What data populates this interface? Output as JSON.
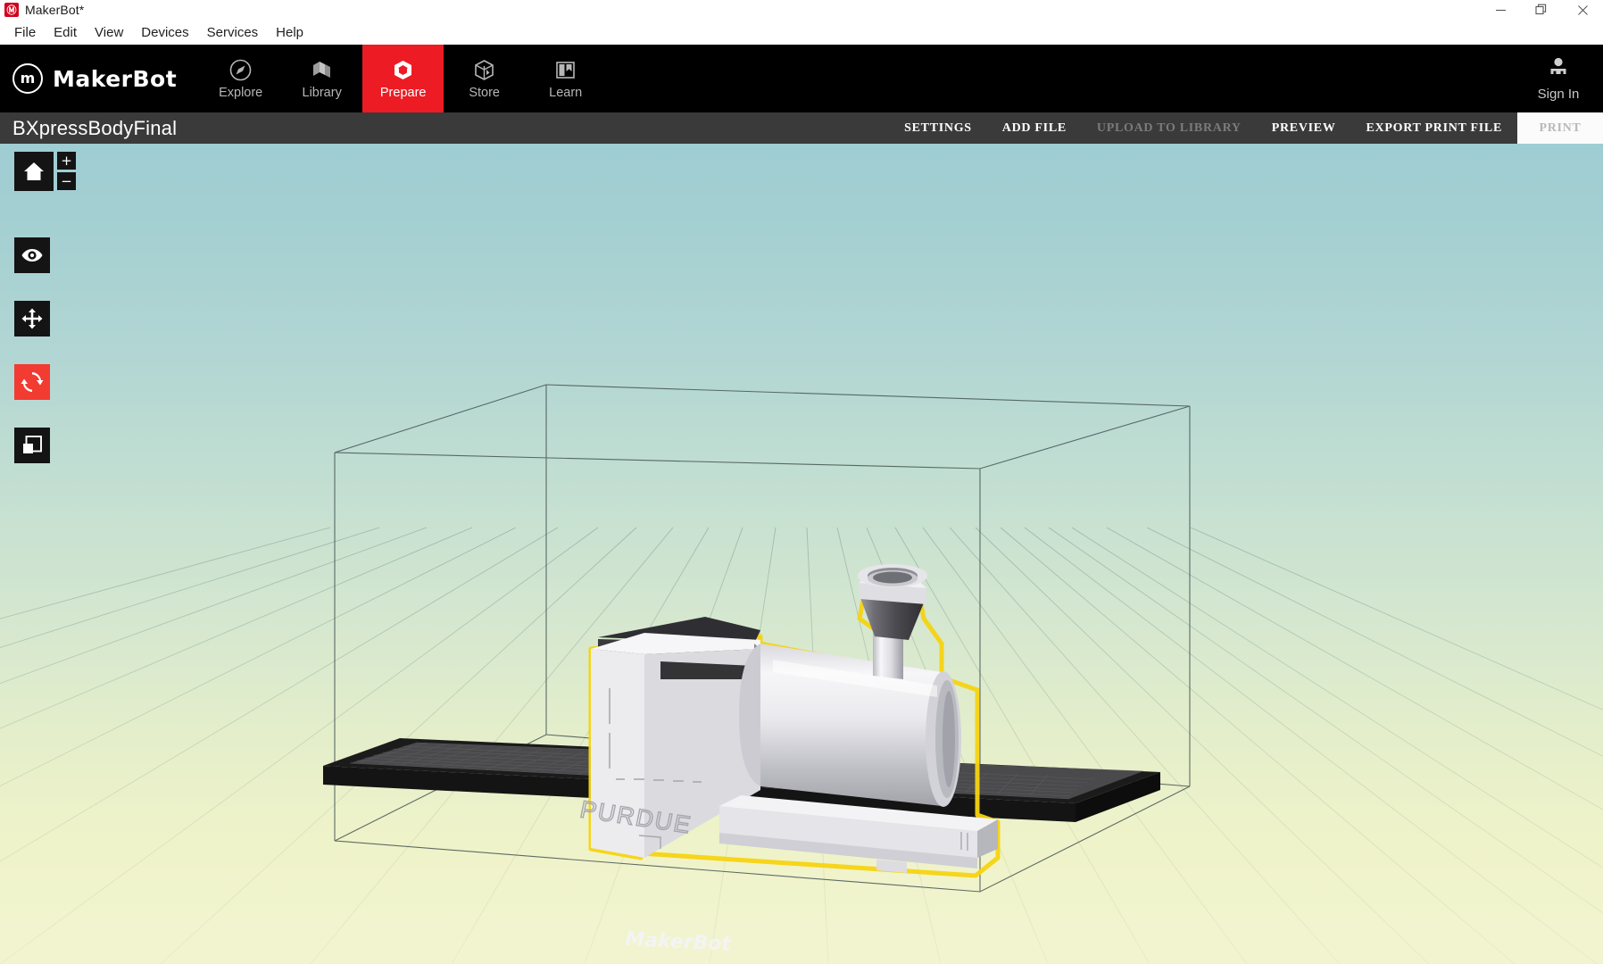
{
  "window": {
    "title": "MakerBot*",
    "app_icon": "makerbot-logo-icon",
    "controls": {
      "minimize": "minimize-icon",
      "restore": "restore-icon",
      "close": "close-icon"
    }
  },
  "menubar": {
    "items": [
      {
        "label": "File"
      },
      {
        "label": "Edit"
      },
      {
        "label": "View"
      },
      {
        "label": "Devices"
      },
      {
        "label": "Services"
      },
      {
        "label": "Help"
      }
    ]
  },
  "navbar": {
    "brand": {
      "mark": "m",
      "name": "MakerBot"
    },
    "tabs": [
      {
        "label": "Explore",
        "icon": "compass-icon",
        "active": false
      },
      {
        "label": "Library",
        "icon": "books-icon",
        "active": false
      },
      {
        "label": "Prepare",
        "icon": "prepare-cube-icon",
        "active": true
      },
      {
        "label": "Store",
        "icon": "box-cube-icon",
        "active": false
      },
      {
        "label": "Learn",
        "icon": "book-bookmark-icon",
        "active": false
      }
    ],
    "account": {
      "label": "Sign In",
      "icon": "user-avatar-icon"
    },
    "accent_color": "#ed1c24"
  },
  "project_toolbar": {
    "title": "BXpressBodyFinal",
    "actions": [
      {
        "label": "SETTINGS",
        "state": "enabled"
      },
      {
        "label": "ADD FILE",
        "state": "enabled"
      },
      {
        "label": "UPLOAD TO LIBRARY",
        "state": "disabled"
      },
      {
        "label": "PREVIEW",
        "state": "enabled"
      },
      {
        "label": "EXPORT PRINT FILE",
        "state": "enabled"
      },
      {
        "label": "PRINT",
        "state": "disabled"
      }
    ]
  },
  "tools": {
    "home": {
      "name": "home-view-button",
      "icon": "home-icon",
      "active": false
    },
    "zoom_in": {
      "label": "+",
      "name": "zoom-in-button"
    },
    "zoom_out": {
      "label": "−",
      "name": "zoom-out-button"
    },
    "items": [
      {
        "name": "view-tool",
        "icon": "eye-icon",
        "active": false
      },
      {
        "name": "move-tool",
        "icon": "move-arrows-icon",
        "active": false
      },
      {
        "name": "rotate-tool",
        "icon": "rotate-icon",
        "active": true
      },
      {
        "name": "scale-tool",
        "icon": "scale-icon",
        "active": false
      }
    ],
    "active_color": "#f23b31"
  },
  "viewport": {
    "build_plate_label": "MakerBot",
    "model": {
      "name": "BXpressBodyFinal",
      "engraved_text": "PURDUE",
      "selected": true,
      "selection_color": "#f5d311",
      "description": "locomotive-model"
    },
    "background": {
      "top_color": "#9ecdd3",
      "bottom_color": "#f2f4d0"
    },
    "build_volume": {
      "wireframe": true,
      "line_color": "#3c4a4a"
    }
  }
}
